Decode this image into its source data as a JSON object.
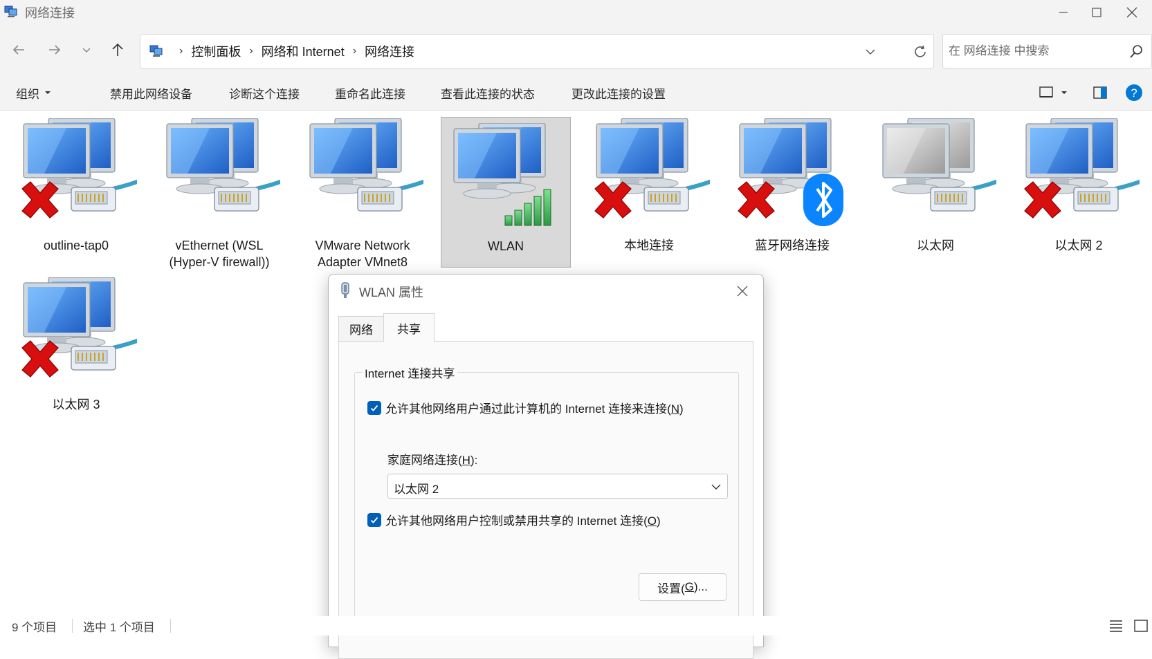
{
  "window": {
    "title": "网络连接"
  },
  "address": {
    "crumbs": [
      "控制面板",
      "网络和 Internet",
      "网络连接"
    ],
    "separator": "›"
  },
  "search": {
    "placeholder": "在 网络连接 中搜索"
  },
  "toolbar": {
    "organize": "组织",
    "actions": [
      "禁用此网络设备",
      "诊断这个连接",
      "重命名此连接",
      "查看此连接的状态",
      "更改此连接的设置"
    ]
  },
  "connections": [
    {
      "name": "outline-tap0",
      "status": "disconnected",
      "icon": "network-pc-icon"
    },
    {
      "name": "vEthernet (WSL\n(Hyper-V firewall))",
      "status": "connected",
      "icon": "network-pc-icon"
    },
    {
      "name": "VMware Network\nAdapter VMnet8",
      "status": "connected",
      "icon": "network-pc-icon"
    },
    {
      "name": "WLAN",
      "status": "wireless",
      "icon": "network-pc-icon",
      "selected": true
    },
    {
      "name": "本地连接",
      "status": "disconnected",
      "icon": "network-pc-icon"
    },
    {
      "name": "蓝牙网络连接",
      "status": "disconnected-bluetooth",
      "icon": "network-pc-icon"
    },
    {
      "name": "以太网",
      "status": "disabled",
      "icon": "network-pc-icon"
    },
    {
      "name": "以太网 2",
      "status": "disconnected",
      "icon": "network-pc-icon"
    },
    {
      "name": "以太网 3",
      "status": "disconnected",
      "icon": "network-pc-icon"
    }
  ],
  "dialog": {
    "title": "WLAN 属性",
    "tabs": [
      "网络",
      "共享"
    ],
    "active_tab": "共享",
    "group_title": "Internet 连接共享",
    "allow_share": {
      "label": "允许其他网络用户通过此计算机的 Internet 连接来连接(",
      "key": "N",
      "suffix": ")",
      "checked": true
    },
    "home_label": {
      "label": "家庭网络连接(",
      "key": "H",
      "suffix": "):"
    },
    "home_value": "以太网 2",
    "allow_control": {
      "label": "允许其他网络用户控制或禁用共享的 Internet 连接(",
      "key": "O",
      "suffix": ")",
      "checked": true
    },
    "settings_button": {
      "label": "设置(",
      "key": "G",
      "suffix": ")..."
    }
  },
  "status": {
    "count": "9 个项目",
    "selected": "选中 1 个项目"
  },
  "colors": {
    "accent": "#005fb8",
    "help": "#0078d4",
    "error_x": "#d80f0f"
  }
}
